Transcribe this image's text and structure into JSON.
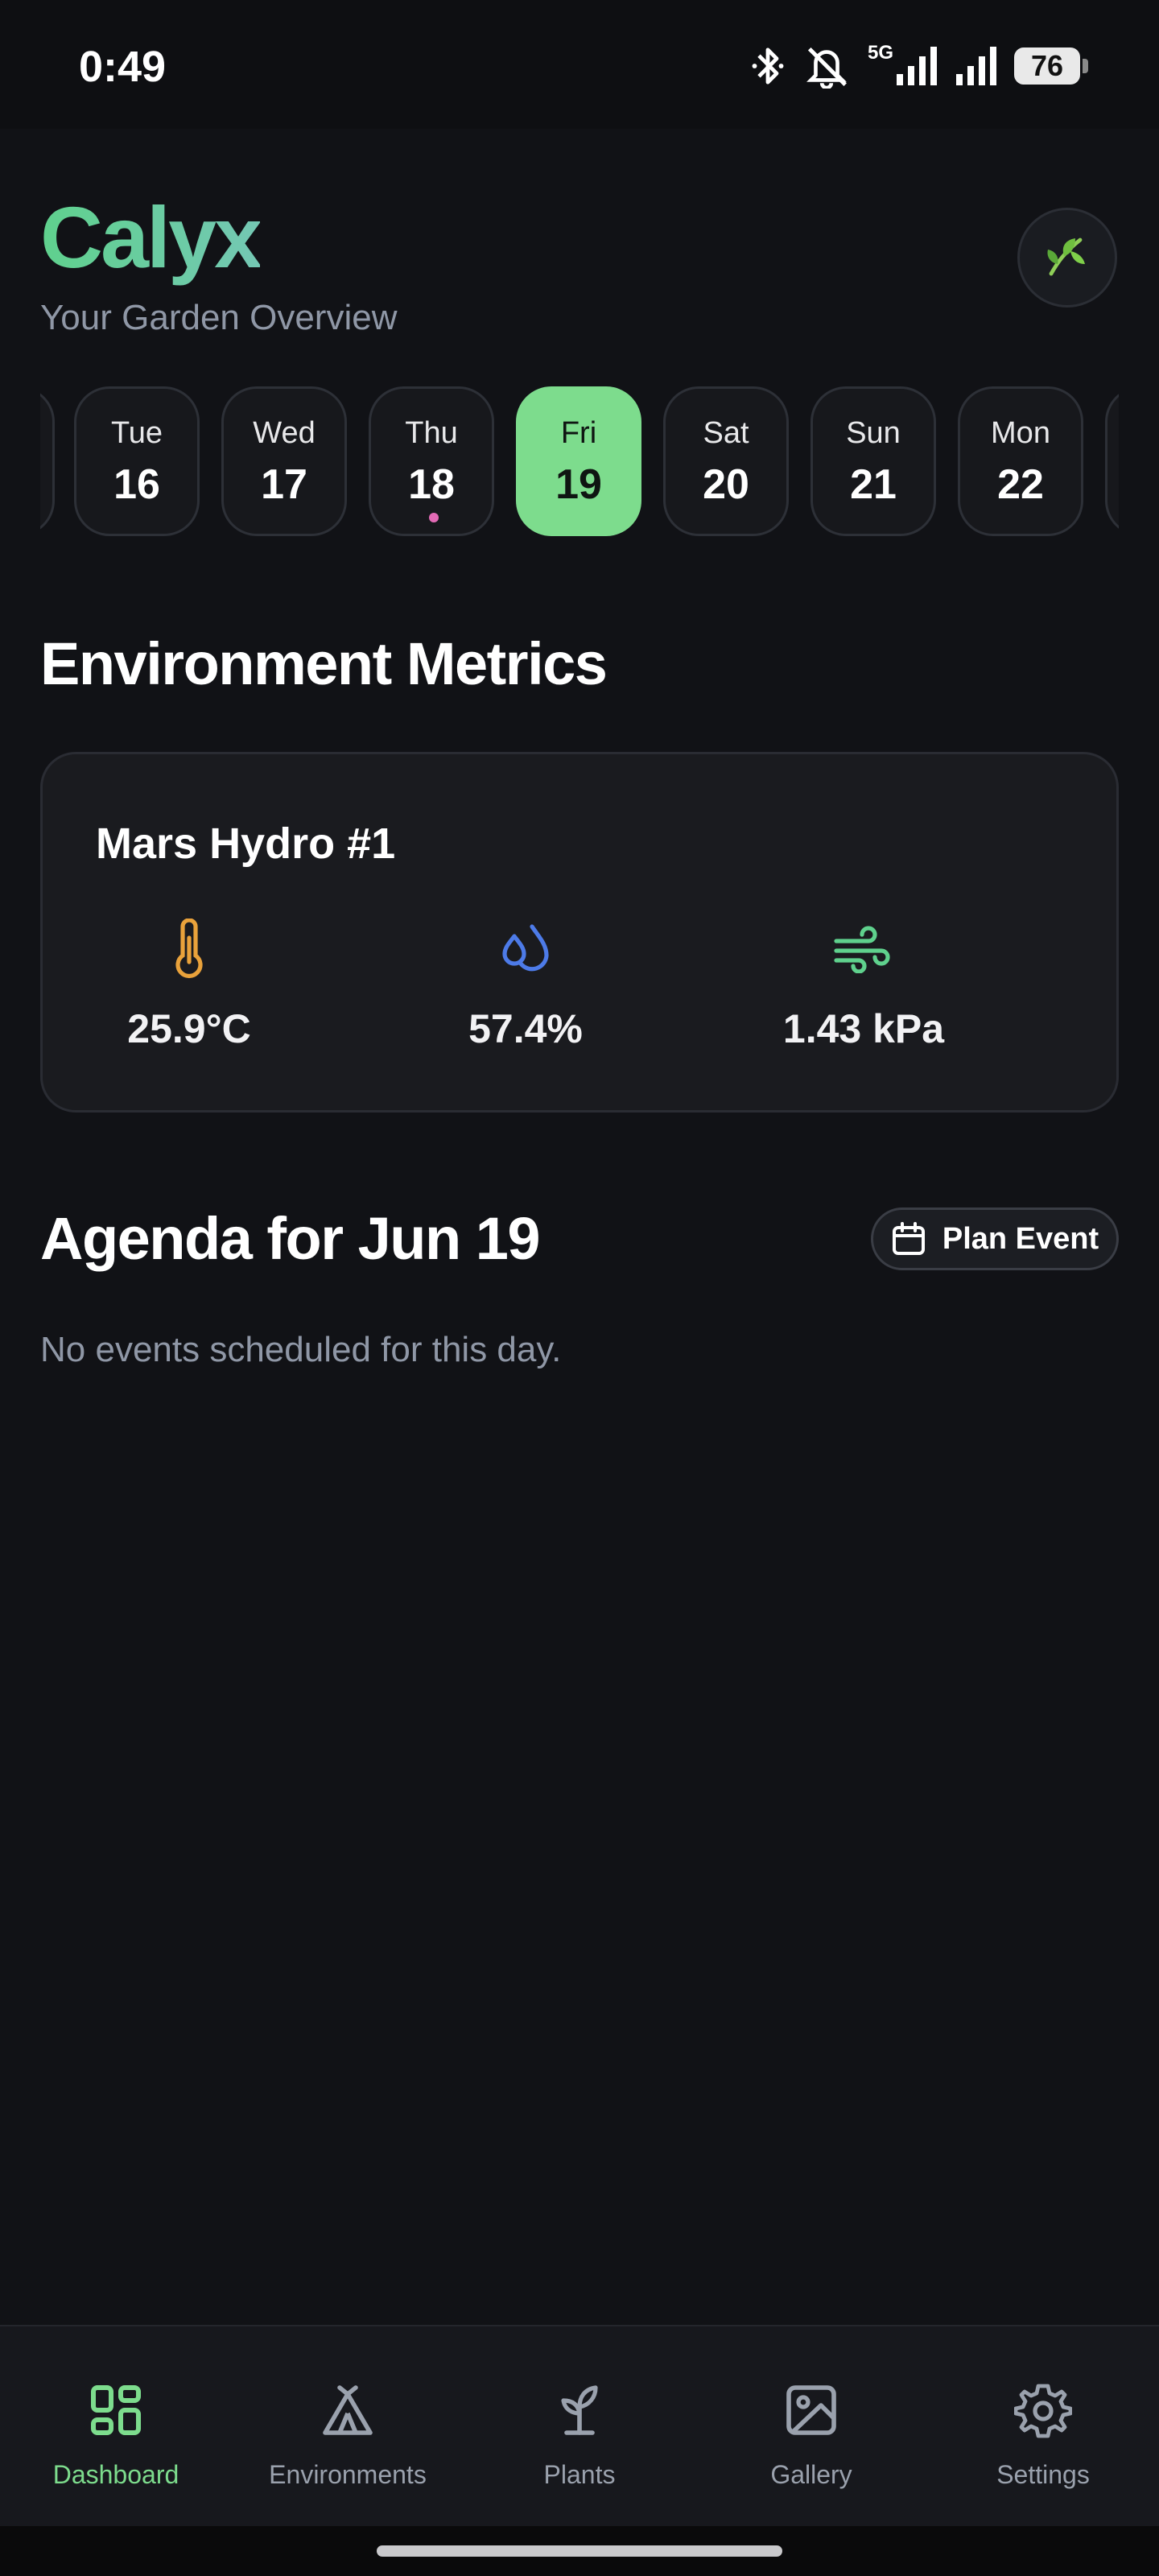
{
  "status_bar": {
    "time": "0:49",
    "network": "5G",
    "battery": "76"
  },
  "header": {
    "title": "Calyx",
    "subtitle": "Your Garden Overview",
    "profile_icon": "leaf-icon"
  },
  "date_strip": {
    "days": [
      {
        "dow": "Tue",
        "num": "16",
        "selected": false,
        "has_event": false
      },
      {
        "dow": "Wed",
        "num": "17",
        "selected": false,
        "has_event": false
      },
      {
        "dow": "Thu",
        "num": "18",
        "selected": false,
        "has_event": true
      },
      {
        "dow": "Fri",
        "num": "19",
        "selected": true,
        "has_event": false
      },
      {
        "dow": "Sat",
        "num": "20",
        "selected": false,
        "has_event": false
      },
      {
        "dow": "Sun",
        "num": "21",
        "selected": false,
        "has_event": false
      },
      {
        "dow": "Mon",
        "num": "22",
        "selected": false,
        "has_event": false
      }
    ]
  },
  "metrics": {
    "heading": "Environment Metrics",
    "card_title": "Mars Hydro #1",
    "temperature": "25.9°C",
    "humidity": "57.4%",
    "vpd": "1.43 kPa"
  },
  "agenda": {
    "heading": "Agenda for Jun 19",
    "plan_label": "Plan Event",
    "empty_text": "No events scheduled for this day."
  },
  "nav": {
    "dashboard": "Dashboard",
    "environments": "Environments",
    "plants": "Plants",
    "gallery": "Gallery",
    "settings": "Settings"
  },
  "colors": {
    "accent": "#7ddc8d",
    "background": "#111216",
    "card": "#1a1b1f",
    "muted_text": "#8f97a6",
    "temperature_icon": "#e9a23b",
    "humidity_icon": "#4d7be8",
    "vpd_icon": "#5fd18d",
    "event_dot": "#e26ab5"
  }
}
